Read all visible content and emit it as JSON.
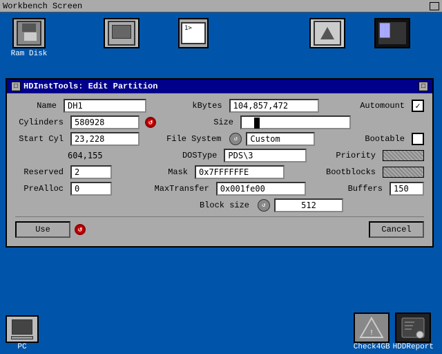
{
  "wb": {
    "title": "Workbench Screen",
    "corner_label": "□"
  },
  "desktop_icons": [
    {
      "label": "Ram Disk",
      "type": "floppy"
    },
    {
      "label": "",
      "type": "monitor"
    },
    {
      "label": "",
      "type": "shell"
    },
    {
      "label": "",
      "type": "triangle"
    },
    {
      "label": "",
      "type": "tv"
    }
  ],
  "bottom_icons": [
    {
      "label": "PC",
      "type": "pc"
    },
    {
      "label": "Check4GB",
      "type": "c4gb"
    },
    {
      "label": "HDDReport",
      "type": "hdd"
    }
  ],
  "dialog": {
    "title": "HDInstTools: Edit Partition",
    "fields": {
      "name_label": "Name",
      "name_value": "DH1",
      "kbytes_label": "kBytes",
      "kbytes_value": "104,857,472",
      "automount_label": "Automount",
      "cylinders_label": "Cylinders",
      "cylinders_value": "580928",
      "size_label": "Size",
      "start_cyl_label": "Start Cyl",
      "start_cyl_value": "23,228",
      "filesystem_label": "File System",
      "filesystem_value": "Custom",
      "extra_value": "604,155",
      "dostype_label": "DOSType",
      "dostype_value": "PDS\\3",
      "bootable_label": "Bootable",
      "reserved_label": "Reserved",
      "reserved_value": "2",
      "mask_label": "Mask",
      "mask_value": "0x7FFFFFFE",
      "priority_label": "Priority",
      "prealloc_label": "PreAlloc",
      "prealloc_value": "0",
      "maxtransfer_label": "MaxTransfer",
      "maxtransfer_value": "0x001fe00",
      "bootblocks_label": "Bootblocks",
      "blocksize_label": "Block size",
      "blocksize_value": "512",
      "buffers_label": "Buffers",
      "buffers_value": "150"
    },
    "buttons": {
      "use_label": "Use",
      "cancel_label": "Cancel"
    }
  }
}
